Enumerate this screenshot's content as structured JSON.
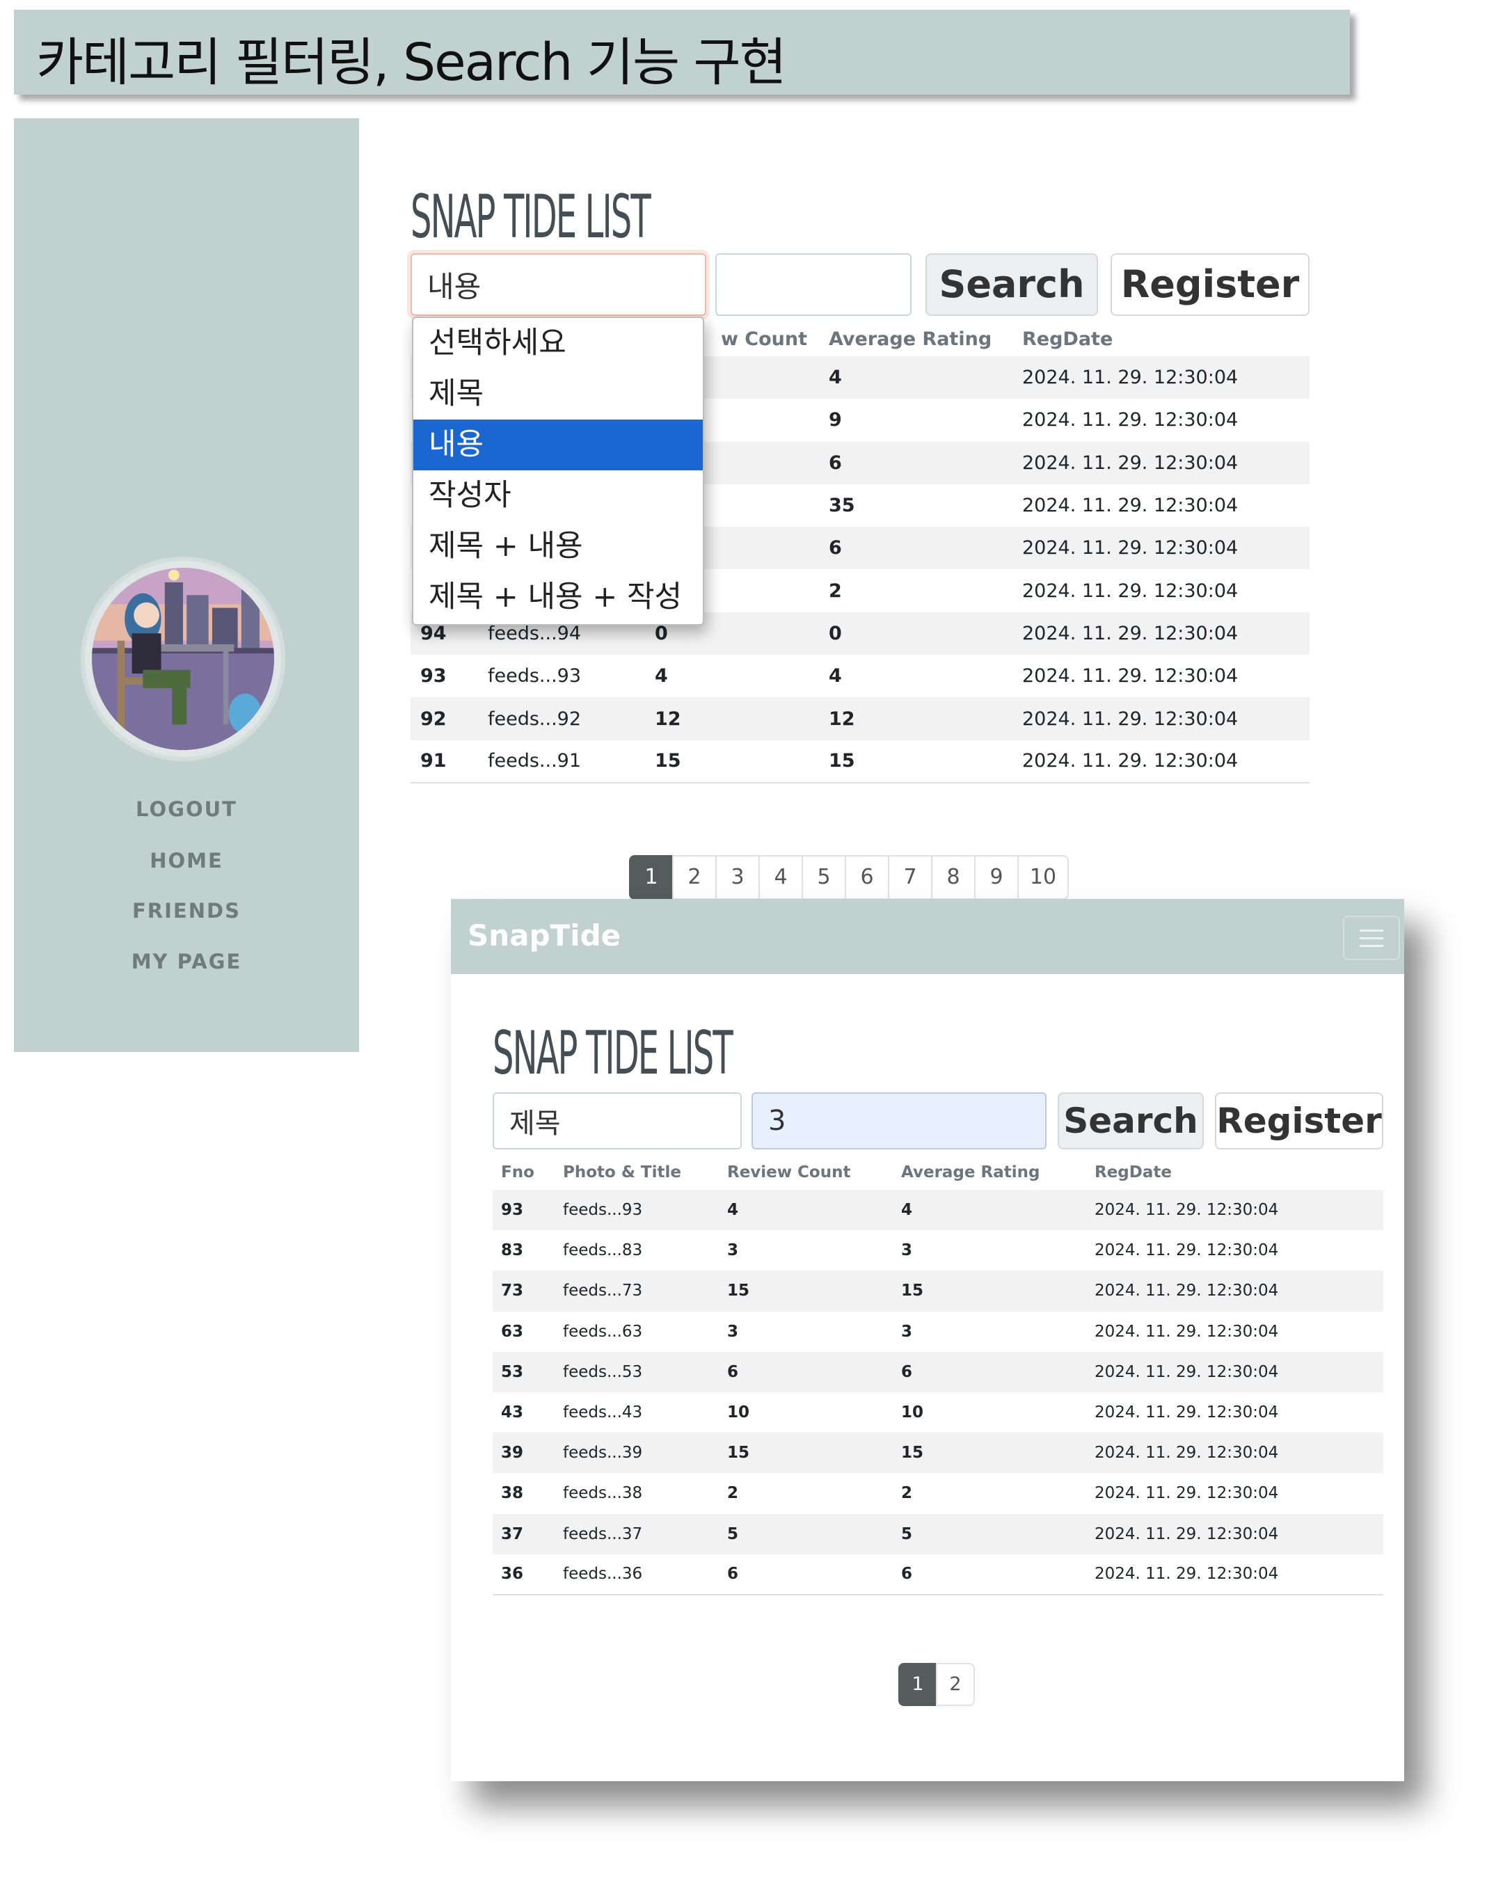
{
  "banner": {
    "text": "카테고리 필터링, Search 기능 구현"
  },
  "sidebar": {
    "nav": [
      {
        "label": "LOGOUT"
      },
      {
        "label": "HOME"
      },
      {
        "label": "FRIENDS"
      },
      {
        "label": "MY PAGE"
      }
    ]
  },
  "view1": {
    "title": "SNAP TIDE  LIST",
    "search_type": "내용",
    "keyword": "",
    "search_button": "Search",
    "register_button": "Register",
    "dropdown_options": [
      "선택하세요",
      "제목",
      "내용",
      "작성자",
      "제목 + 내용",
      "제목 + 내용 + 작성자"
    ],
    "headers": {
      "review": "w Count",
      "rating": "Average Rating",
      "regdate": "RegDate"
    },
    "rows": [
      {
        "fno": "",
        "title": "",
        "review": "",
        "rating": "4",
        "regdate": "2024. 11. 29. 12:30:04"
      },
      {
        "fno": "",
        "title": "",
        "review": "",
        "rating": "9",
        "regdate": "2024. 11. 29. 12:30:04"
      },
      {
        "fno": "",
        "title": "",
        "review": "",
        "rating": "6",
        "regdate": "2024. 11. 29. 12:30:04"
      },
      {
        "fno": "",
        "title": "",
        "review": "",
        "rating": "35",
        "regdate": "2024. 11. 29. 12:30:04"
      },
      {
        "fno": "",
        "title": "",
        "review": "",
        "rating": "6",
        "regdate": "2024. 11. 29. 12:30:04"
      },
      {
        "fno": "",
        "title": "",
        "review": "",
        "rating": "2",
        "regdate": "2024. 11. 29. 12:30:04"
      },
      {
        "fno": "94",
        "title": "feeds...94",
        "review": "0",
        "rating": "0",
        "regdate": "2024. 11. 29. 12:30:04"
      },
      {
        "fno": "93",
        "title": "feeds...93",
        "review": "4",
        "rating": "4",
        "regdate": "2024. 11. 29. 12:30:04"
      },
      {
        "fno": "92",
        "title": "feeds...92",
        "review": "12",
        "rating": "12",
        "regdate": "2024. 11. 29. 12:30:04"
      },
      {
        "fno": "91",
        "title": "feeds...91",
        "review": "15",
        "rating": "15",
        "regdate": "2024. 11. 29. 12:30:04"
      }
    ],
    "pages": [
      "1",
      "2",
      "3",
      "4",
      "5",
      "6",
      "7",
      "8",
      "9",
      "10"
    ],
    "active_page": "1"
  },
  "view2": {
    "brand": "SnapTide",
    "title": "SNAP TIDE  LIST",
    "search_type": "제목",
    "keyword": "3",
    "search_button": "Search",
    "register_button": "Register",
    "headers": {
      "fno": "Fno",
      "title": "Photo & Title",
      "review": "Review Count",
      "rating": "Average Rating",
      "regdate": "RegDate"
    },
    "rows": [
      {
        "fno": "93",
        "title": "feeds...93",
        "review": "4",
        "rating": "4",
        "regdate": "2024. 11. 29. 12:30:04"
      },
      {
        "fno": "83",
        "title": "feeds...83",
        "review": "3",
        "rating": "3",
        "regdate": "2024. 11. 29. 12:30:04"
      },
      {
        "fno": "73",
        "title": "feeds...73",
        "review": "15",
        "rating": "15",
        "regdate": "2024. 11. 29. 12:30:04"
      },
      {
        "fno": "63",
        "title": "feeds...63",
        "review": "3",
        "rating": "3",
        "regdate": "2024. 11. 29. 12:30:04"
      },
      {
        "fno": "53",
        "title": "feeds...53",
        "review": "6",
        "rating": "6",
        "regdate": "2024. 11. 29. 12:30:04"
      },
      {
        "fno": "43",
        "title": "feeds...43",
        "review": "10",
        "rating": "10",
        "regdate": "2024. 11. 29. 12:30:04"
      },
      {
        "fno": "39",
        "title": "feeds...39",
        "review": "15",
        "rating": "15",
        "regdate": "2024. 11. 29. 12:30:04"
      },
      {
        "fno": "38",
        "title": "feeds...38",
        "review": "2",
        "rating": "2",
        "regdate": "2024. 11. 29. 12:30:04"
      },
      {
        "fno": "37",
        "title": "feeds...37",
        "review": "5",
        "rating": "5",
        "regdate": "2024. 11. 29. 12:30:04"
      },
      {
        "fno": "36",
        "title": "feeds...36",
        "review": "6",
        "rating": "6",
        "regdate": "2024. 11. 29. 12:30:04"
      }
    ],
    "pages": [
      "1",
      "2"
    ],
    "active_page": "1"
  },
  "colors": {
    "sidebar": "#c0d1cf",
    "selected_option": "#1a67d2",
    "active_page": "#555d5c",
    "keyword_field": "#e8f0fe"
  }
}
